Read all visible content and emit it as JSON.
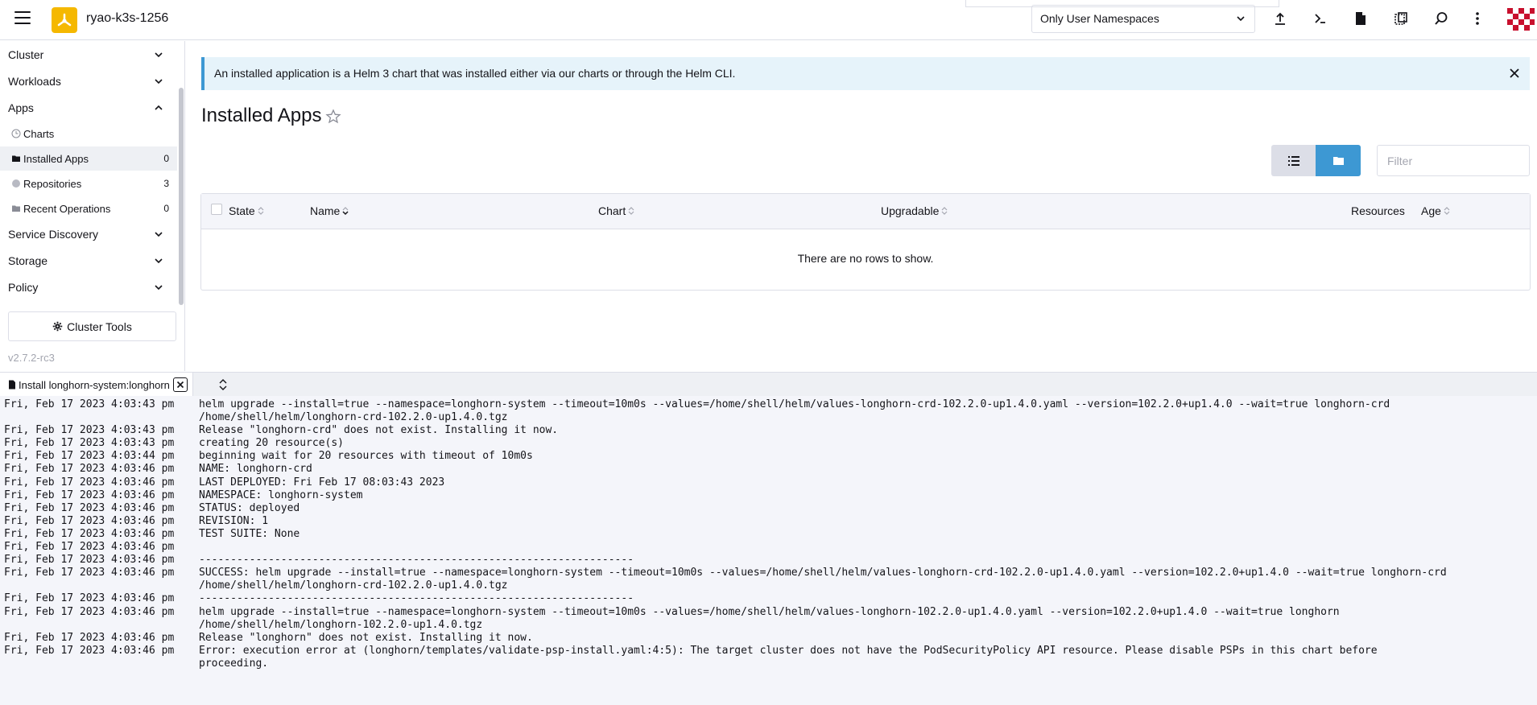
{
  "header": {
    "cluster_name": "ryao-k3s-1256",
    "namespace_filter": "Only User Namespaces",
    "icons": [
      "menu-icon",
      "rancher-logo-icon",
      "upload-icon",
      "kubectl-shell-icon",
      "kubeconfig-file-icon",
      "copy-kubeconfig-icon",
      "search-icon",
      "more-vertical-icon",
      "user-avatar"
    ]
  },
  "sidebar": {
    "groups": [
      {
        "label": "Cluster",
        "expanded": false
      },
      {
        "label": "Workloads",
        "expanded": false
      },
      {
        "label": "Apps",
        "expanded": true
      },
      {
        "label": "Service Discovery",
        "expanded": false
      },
      {
        "label": "Storage",
        "expanded": false
      },
      {
        "label": "Policy",
        "expanded": false
      }
    ],
    "apps_items": [
      {
        "label": "Charts",
        "count": "",
        "icon": "charts-icon"
      },
      {
        "label": "Installed Apps",
        "count": "0",
        "icon": "folder-icon",
        "active": true
      },
      {
        "label": "Repositories",
        "count": "3",
        "icon": "repository-icon"
      },
      {
        "label": "Recent Operations",
        "count": "0",
        "icon": "folder-icon"
      }
    ],
    "cluster_tools": "Cluster Tools",
    "version": "v2.7.2-rc3"
  },
  "main": {
    "banner": "An installed application is a Helm 3 chart that was installed either via our charts or through the Helm CLI.",
    "title": "Installed Apps",
    "filter_placeholder": "Filter",
    "columns": [
      "State",
      "Name",
      "Chart",
      "Upgradable",
      "Resources",
      "Age"
    ],
    "empty_text": "There are no rows to show."
  },
  "log_panel": {
    "tab_label": "Install longhorn-system:longhorn",
    "lines": [
      {
        "t": "Fri, Feb 17 2023 4:03:43 pm",
        "m": "helm upgrade --install=true --namespace=longhorn-system --timeout=10m0s --values=/home/shell/helm/values-longhorn-crd-102.2.0-up1.4.0.yaml --version=102.2.0+up1.4.0 --wait=true longhorn-crd\n/home/shell/helm/longhorn-crd-102.2.0-up1.4.0.tgz"
      },
      {
        "t": "Fri, Feb 17 2023 4:03:43 pm",
        "m": "Release \"longhorn-crd\" does not exist. Installing it now."
      },
      {
        "t": "Fri, Feb 17 2023 4:03:43 pm",
        "m": "creating 20 resource(s)"
      },
      {
        "t": "Fri, Feb 17 2023 4:03:44 pm",
        "m": "beginning wait for 20 resources with timeout of 10m0s"
      },
      {
        "t": "Fri, Feb 17 2023 4:03:46 pm",
        "m": "NAME: longhorn-crd"
      },
      {
        "t": "Fri, Feb 17 2023 4:03:46 pm",
        "m": "LAST DEPLOYED: Fri Feb 17 08:03:43 2023"
      },
      {
        "t": "Fri, Feb 17 2023 4:03:46 pm",
        "m": "NAMESPACE: longhorn-system"
      },
      {
        "t": "Fri, Feb 17 2023 4:03:46 pm",
        "m": "STATUS: deployed"
      },
      {
        "t": "Fri, Feb 17 2023 4:03:46 pm",
        "m": "REVISION: 1"
      },
      {
        "t": "Fri, Feb 17 2023 4:03:46 pm",
        "m": "TEST SUITE: None"
      },
      {
        "t": "Fri, Feb 17 2023 4:03:46 pm",
        "m": ""
      },
      {
        "t": "Fri, Feb 17 2023 4:03:46 pm",
        "m": "---------------------------------------------------------------------"
      },
      {
        "t": "Fri, Feb 17 2023 4:03:46 pm",
        "m": "SUCCESS: helm upgrade --install=true --namespace=longhorn-system --timeout=10m0s --values=/home/shell/helm/values-longhorn-crd-102.2.0-up1.4.0.yaml --version=102.2.0+up1.4.0 --wait=true longhorn-crd\n/home/shell/helm/longhorn-crd-102.2.0-up1.4.0.tgz"
      },
      {
        "t": "Fri, Feb 17 2023 4:03:46 pm",
        "m": "---------------------------------------------------------------------"
      },
      {
        "t": "Fri, Feb 17 2023 4:03:46 pm",
        "m": "helm upgrade --install=true --namespace=longhorn-system --timeout=10m0s --values=/home/shell/helm/values-longhorn-102.2.0-up1.4.0.yaml --version=102.2.0+up1.4.0 --wait=true longhorn\n/home/shell/helm/longhorn-102.2.0-up1.4.0.tgz"
      },
      {
        "t": "Fri, Feb 17 2023 4:03:46 pm",
        "m": "Release \"longhorn\" does not exist. Installing it now."
      },
      {
        "t": "Fri, Feb 17 2023 4:03:46 pm",
        "m": "Error: execution error at (longhorn/templates/validate-psp-install.yaml:4:5): The target cluster does not have the PodSecurityPolicy API resource. Please disable PSPs in this chart before\nproceeding."
      }
    ]
  },
  "colors": {
    "accent": "#3d98d3",
    "banner_bg": "#e6f3fa",
    "brand": "#f5b800",
    "border": "#dcdee7"
  }
}
